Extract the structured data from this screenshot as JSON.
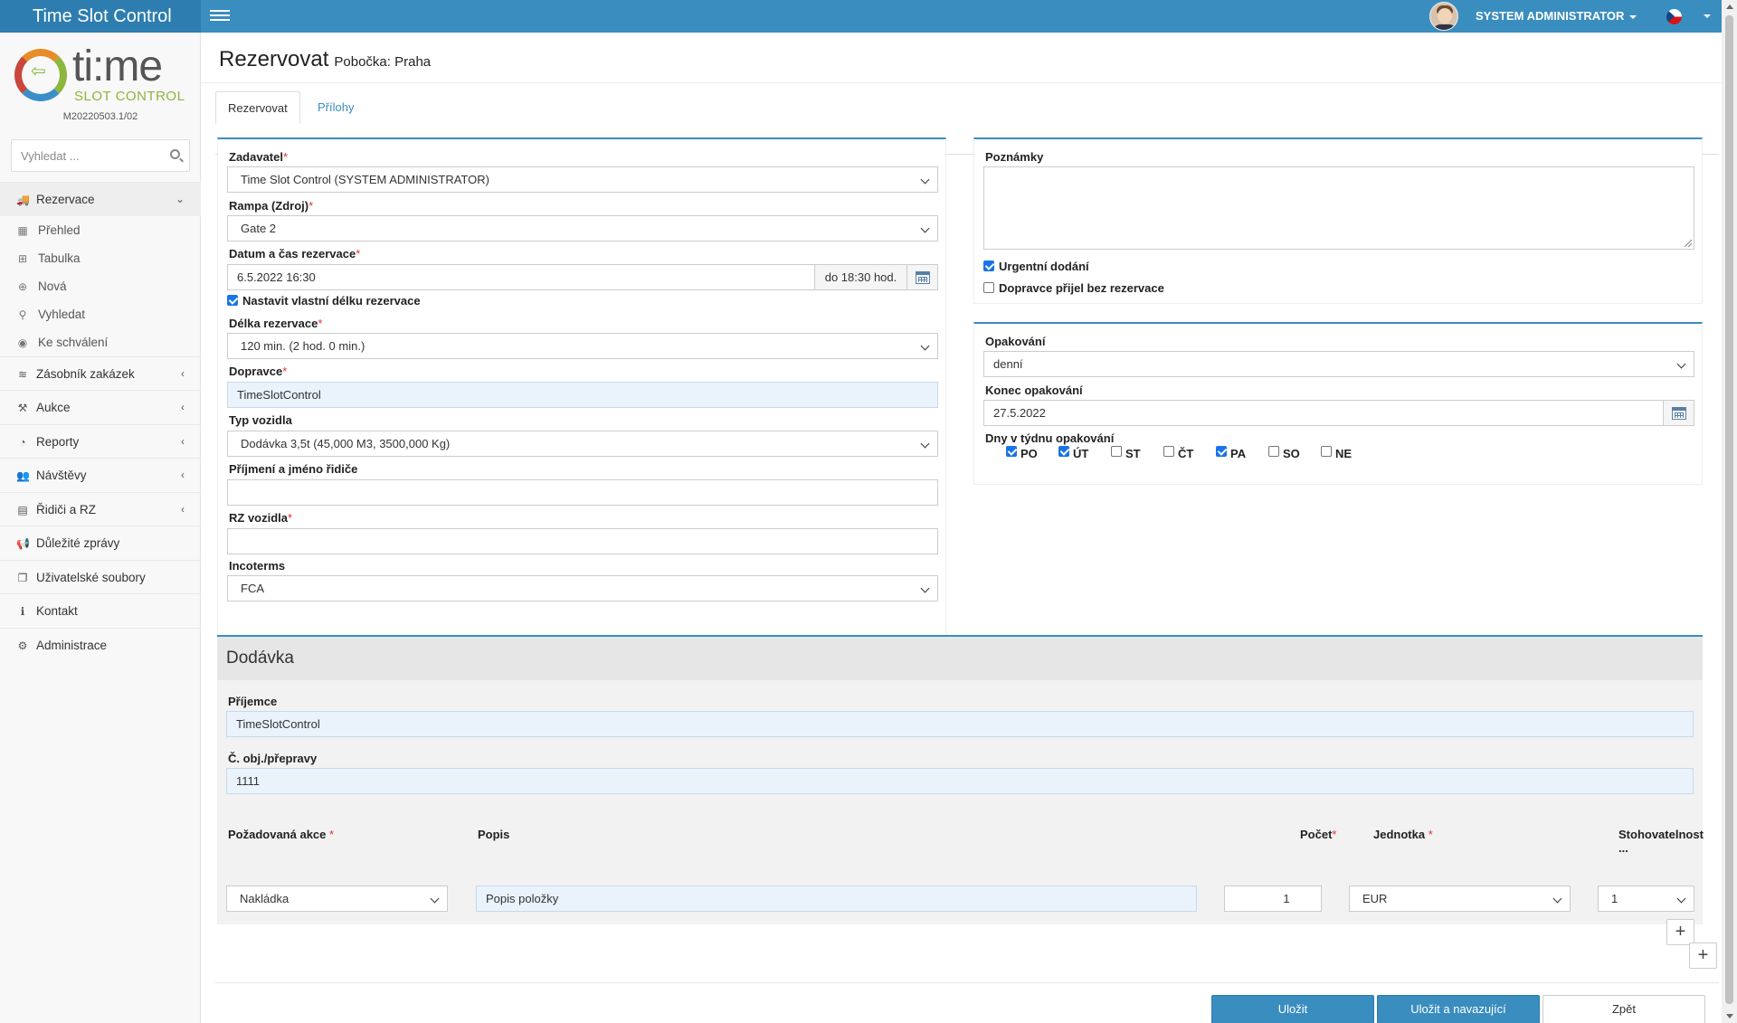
{
  "app": {
    "title": "Time Slot Control",
    "version": "M20220503.1/02"
  },
  "logo": {
    "main": "ti:me",
    "sub": "SLOT CONTROL"
  },
  "user": {
    "name": "SYSTEM ADMINISTRATOR"
  },
  "search": {
    "placeholder": "Vyhledat ..."
  },
  "menu": {
    "reservations": "Rezervace",
    "sub": [
      "Přehled",
      "Tabulka",
      "Nová",
      "Vyhledat",
      "Ke schválení"
    ],
    "items": [
      "Zásobník zakázek",
      "Aukce",
      "Reporty",
      "Návštěvy",
      "Řidiči a RZ",
      "Důležité zprávy",
      "Uživatelské soubory",
      "Kontakt",
      "Administrace"
    ]
  },
  "page": {
    "title": "Rezervovat",
    "branch": "Pobočka: Praha"
  },
  "tabs": [
    "Rezervovat",
    "Přílohy"
  ],
  "form": {
    "requester_label": "Zadavatel",
    "requester_value": "Time Slot Control (SYSTEM ADMINISTRATOR)",
    "ramp_label": "Rampa (Zdroj)",
    "ramp_value": "Gate 2",
    "datetime_label": "Datum a čas rezervace",
    "datetime_value": "6.5.2022 16:30",
    "until": "do 18:30 hod.",
    "custom_length_label": "Nastavit vlastní délku rezervace",
    "length_label": "Délka rezervace",
    "length_value": "120 min. (2 hod. 0 min.)",
    "carrier_label": "Dopravce",
    "carrier_value": "TimeSlotControl",
    "vehicle_type_label": "Typ vozidla",
    "vehicle_type_value": "Dodávka 3,5t (45,000 M3, 3500,000 Kg)",
    "driver_label": "Příjmení a jméno řidiče",
    "driver_value": "",
    "plate_label": "RZ vozidla",
    "plate_value": "",
    "incoterms_label": "Incoterms",
    "incoterms_value": "FCA"
  },
  "notes": {
    "label": "Poznámky",
    "value": "",
    "urgent_label": "Urgentní dodání",
    "no_reservation_label": "Dopravce přijel bez rezervace"
  },
  "repeat": {
    "label": "Opakování",
    "value": "denní",
    "end_label": "Konec opakování",
    "end_value": "27.5.2022",
    "days_label": "Dny v týdnu opakování",
    "days": [
      "PO",
      "ÚT",
      "ST",
      "ČT",
      "PA",
      "SO",
      "NE"
    ],
    "days_checked": [
      true,
      true,
      false,
      false,
      true,
      false,
      false
    ]
  },
  "delivery": {
    "title": "Dodávka",
    "recipient_label": "Příjemce",
    "recipient_value": "TimeSlotControl",
    "order_label": "Č. obj./přepravy",
    "order_value": "1111",
    "col_action": "Požadovaná akce",
    "col_desc": "Popis",
    "col_count": "Počet",
    "col_unit": "Jednotka",
    "col_stack": "Stohovatelnost ...",
    "row_action": "Nakládka",
    "row_desc": "Popis položky",
    "row_count": "1",
    "row_unit": "EUR",
    "row_stack": "1"
  },
  "buttons": {
    "save": "Uložit",
    "save_next": "Uložit a navazující",
    "back": "Zpět"
  },
  "colors": {
    "primary": "#3a8dbf",
    "required": "#d33",
    "field_highlight": "#eaf3fb"
  }
}
